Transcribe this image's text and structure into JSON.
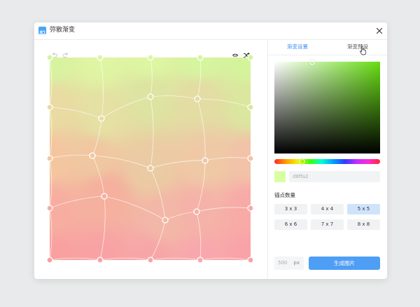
{
  "window": {
    "title": "弥散渐变",
    "close_label": "×"
  },
  "toolbar": {
    "undo": "undo-icon",
    "redo": "redo-icon",
    "preview": "eye-icon",
    "shuffle": "shuffle-icon"
  },
  "canvas": {
    "rows": 5,
    "cols": 5,
    "points": [
      {
        "color": "#d8f3a0"
      },
      {
        "color": "#dff5a3"
      },
      {
        "color": "#dcf6a2"
      },
      {
        "color": "#d6f59f"
      },
      {
        "color": "#d4f49c"
      },
      {
        "color": "#e9dba2"
      },
      {
        "color": "#e5e0a3"
      },
      {
        "color": "#dde3a1"
      },
      {
        "color": "#e3dca3"
      },
      {
        "color": "#dbe69f"
      },
      {
        "color": "#f4c6a0"
      },
      {
        "color": "#f0c7a1"
      },
      {
        "color": "#ebcba3"
      },
      {
        "color": "#efc9a6"
      },
      {
        "color": "#f2c3a8"
      },
      {
        "color": "#f7aea0"
      },
      {
        "color": "#f5b09e"
      },
      {
        "color": "#f3b7a7"
      },
      {
        "color": "#f5b2a8"
      },
      {
        "color": "#f8aaa7"
      },
      {
        "color": "#f9a0a0"
      },
      {
        "color": "#f8a2a4"
      },
      {
        "color": "#f7a6a8"
      },
      {
        "color": "#f8a8ac"
      },
      {
        "color": "#f9a2a8"
      }
    ]
  },
  "tabs": [
    {
      "label": "渐变设置",
      "active": true
    },
    {
      "label": "渐变预设",
      "active": false
    }
  ],
  "color": {
    "hex": "d8ffa2",
    "swatch": "#d8ffa2",
    "hue_color": "#66dd11"
  },
  "anchor": {
    "label": "锚点数量",
    "options": [
      "3 x 3",
      "4 x 4",
      "5 x 5",
      "6 x 6",
      "7 x 7",
      "8 x 8"
    ],
    "selected": "5 x 5"
  },
  "output": {
    "size_value": "500",
    "size_unit": "px",
    "generate_label": "生成图片"
  },
  "colors": {
    "accent": "#4f9ef5",
    "selected_bg": "#cfe3fb"
  }
}
